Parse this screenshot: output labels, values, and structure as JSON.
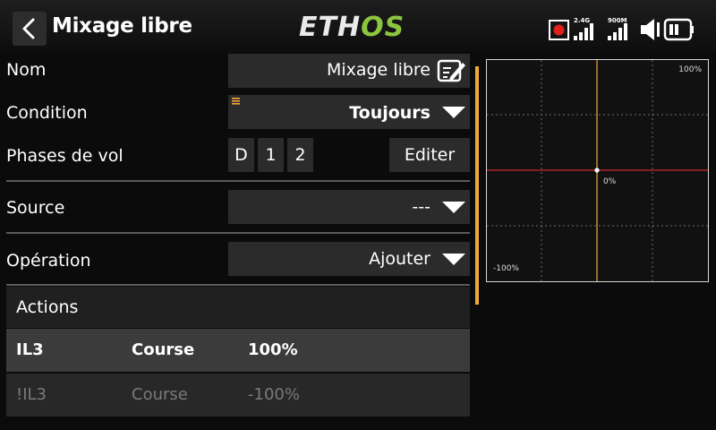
{
  "header": {
    "title": "Mixage libre",
    "logo_part1": "ETH",
    "logo_part2": "OS",
    "status": {
      "band1": "2.4G",
      "band2": "900M"
    }
  },
  "form": {
    "name": {
      "label": "Nom",
      "value": "Mixage libre"
    },
    "condition": {
      "label": "Condition",
      "value": "Toujours"
    },
    "phases": {
      "label": "Phases de vol",
      "items": [
        "D",
        "1",
        "2"
      ],
      "edit_label": "Editer"
    },
    "source": {
      "label": "Source",
      "value": "---"
    },
    "operation": {
      "label": "Opération",
      "value": "Ajouter"
    }
  },
  "actions": {
    "title": "Actions",
    "rows": [
      {
        "source": "IL3",
        "type": "Course",
        "value": "100%"
      },
      {
        "source": "!IL3",
        "type": "Course",
        "value": "-100%"
      }
    ]
  },
  "graph": {
    "top_label": "100%",
    "center_label": "0%",
    "bottom_label": "-100%"
  },
  "colors": {
    "accent": "#f2a93b",
    "logo_green": "#8cc63f",
    "record_red": "#e0201b",
    "curve_red": "#d02828"
  }
}
